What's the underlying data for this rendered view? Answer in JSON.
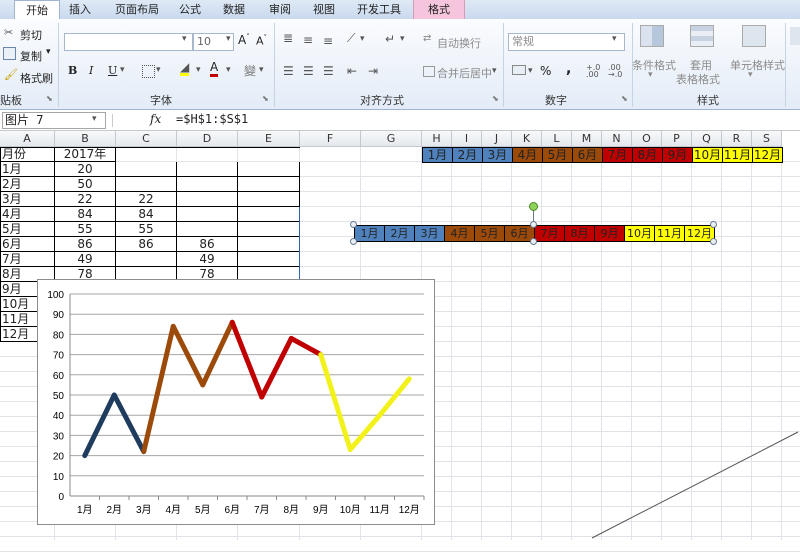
{
  "ribbon_tabs": [
    "开始",
    "插入",
    "页面布局",
    "公式",
    "数据",
    "审阅",
    "视图",
    "开发工具",
    "格式"
  ],
  "clipboard": {
    "cut": "剪切",
    "copy": "复制",
    "format_painter": "格式刷",
    "group": "贴板"
  },
  "font": {
    "size": "10",
    "group": "字体",
    "bold": "B",
    "italic": "I",
    "underline": "U"
  },
  "alignment": {
    "wrap": "自动换行",
    "merge": "合并后居中",
    "group": "对齐方式"
  },
  "number": {
    "format": "常规",
    "percent": "%",
    "comma": ",",
    "group": "数字"
  },
  "styles": {
    "conditional": "条件格式",
    "table": "套用",
    "table2": "表格格式",
    "cell": "单元格样式",
    "group": "样式"
  },
  "formula_bar": {
    "name_box": "图片 7",
    "fx": "fx",
    "formula": "=$H$1:$S$1"
  },
  "columns": [
    "A",
    "B",
    "C",
    "D",
    "E",
    "F",
    "G",
    "H",
    "I",
    "J",
    "K",
    "L",
    "M",
    "N",
    "O",
    "P",
    "Q",
    "R",
    "S"
  ],
  "sheet": {
    "a1": "月份",
    "b1": "2017年",
    "months": [
      "1月",
      "2月",
      "3月",
      "4月",
      "5月",
      "6月",
      "7月",
      "8月",
      "9月",
      "10月",
      "11月",
      "12月"
    ],
    "b_values": [
      "20",
      "50",
      "22",
      "84",
      "55",
      "86",
      "49",
      "78"
    ],
    "c_values": [
      "",
      "",
      "22",
      "84",
      "55",
      "86",
      "",
      ""
    ],
    "d_values": [
      "",
      "",
      "",
      "",
      "",
      "86",
      "49",
      "78"
    ]
  },
  "header_months": [
    "1月",
    "2月",
    "3月",
    "4月",
    "5月",
    "6月",
    "7月",
    "8月",
    "9月",
    "10月",
    "11月",
    "12月"
  ],
  "colors": {
    "blue": "#4f81bd",
    "brown": "#9c4a0a",
    "red": "#c00000",
    "yellow": "#ffff00",
    "line_blue": "#1f3c5e",
    "line_brown": "#9c4a0a",
    "line_red": "#c00000",
    "line_yellow": "#f2f21a"
  },
  "chart_data": {
    "type": "line",
    "categories": [
      "1月",
      "2月",
      "3月",
      "4月",
      "5月",
      "6月",
      "7月",
      "8月",
      "9月",
      "10月",
      "11月",
      "12月"
    ],
    "series": [
      {
        "values": [
          20,
          50,
          22,
          84,
          55,
          86,
          49,
          78,
          70,
          23,
          40,
          58
        ],
        "segment_colors": [
          "#1f3c5e",
          "#1f3c5e",
          "#9c4a0a",
          "#9c4a0a",
          "#9c4a0a",
          "#c00000",
          "#c00000",
          "#c00000",
          "#f2f21a",
          "#f2f21a",
          "#f2f21a"
        ]
      }
    ],
    "ylim": [
      0,
      100
    ],
    "yticks": [
      0,
      10,
      20,
      30,
      40,
      50,
      60,
      70,
      80,
      90,
      100
    ],
    "grid": true
  }
}
